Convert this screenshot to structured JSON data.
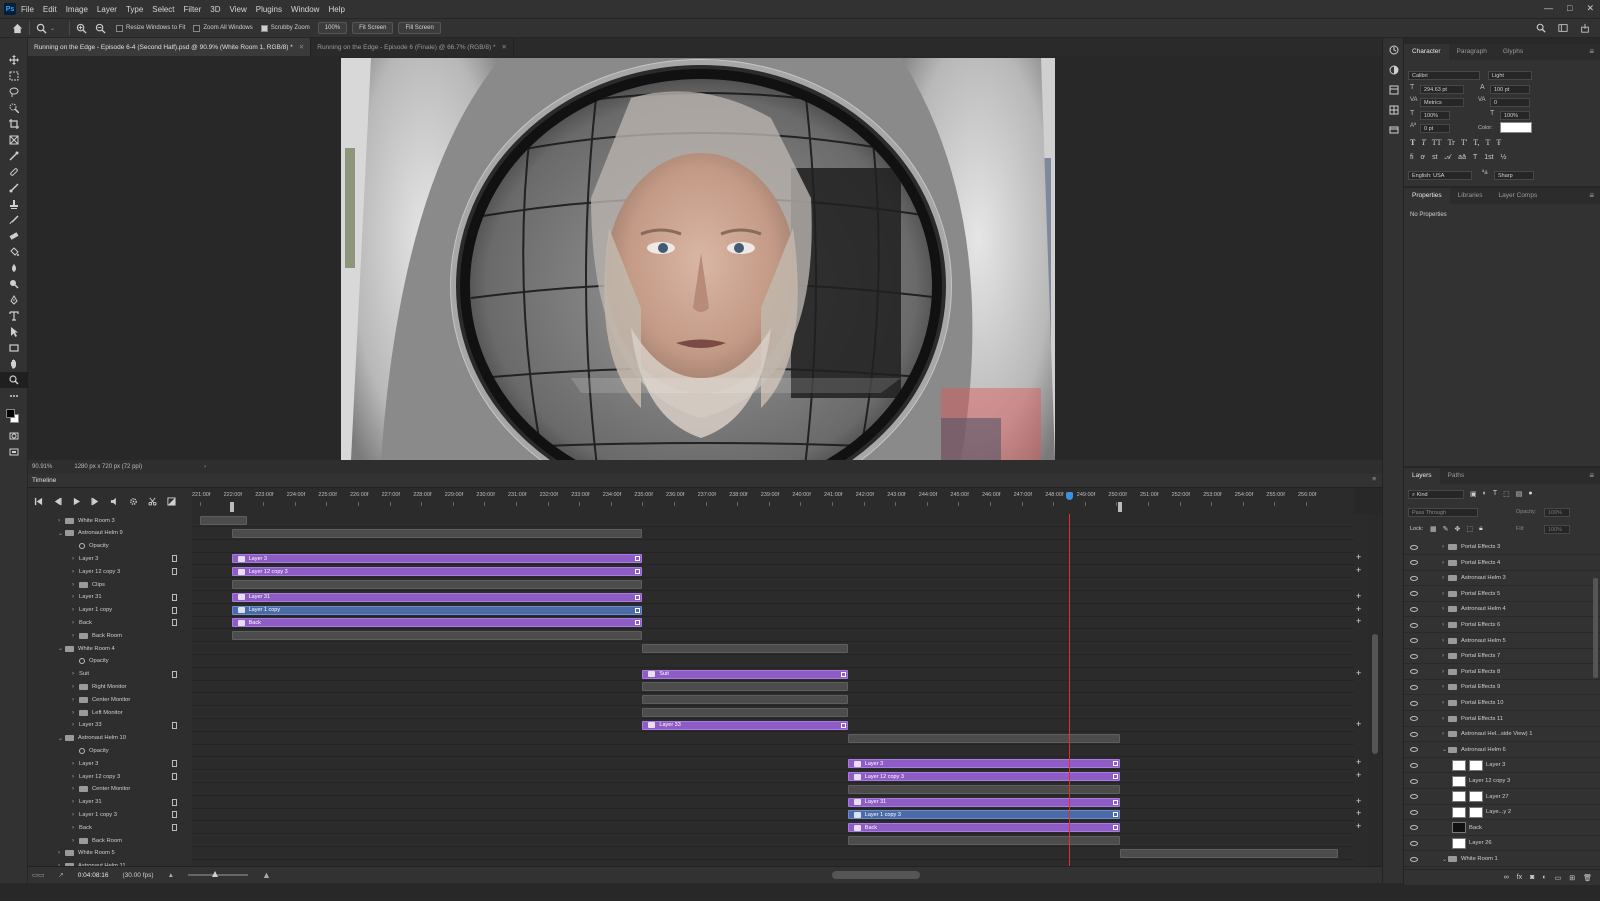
{
  "menu": [
    "File",
    "Edit",
    "Image",
    "Layer",
    "Type",
    "Select",
    "Filter",
    "3D",
    "View",
    "Plugins",
    "Window",
    "Help"
  ],
  "ps_logo": "Ps",
  "window_controls": [
    "—",
    "□",
    "✕"
  ],
  "options": {
    "resize_windows": "Resize Windows to Fit",
    "zoom_all": "Zoom All Windows",
    "scrubby_zoom": "Scrubby Zoom",
    "zoom_value": "100%",
    "fit_screen": "Fit Screen",
    "fill_screen": "Fill Screen"
  },
  "tabs": [
    {
      "label": "Running on the Edge - Episode 6-4 (Second Half).psd @ 90.9% (White Room 1, RGB/8) *",
      "active": true
    },
    {
      "label": "Running on the Edge - Episode 6 (Finale) @ 66.7% (RGB/8) *",
      "active": false
    }
  ],
  "status": {
    "zoom": "90.91%",
    "size": "1280 px x 720 px (72 ppi)"
  },
  "timeline": {
    "title": "Timeline",
    "ruler": [
      "221:00f",
      "222:00f",
      "223:00f",
      "224:00f",
      "225:00f",
      "226:00f",
      "227:00f",
      "228:00f",
      "229:00f",
      "230:00f",
      "231:00f",
      "232:00f",
      "233:00f",
      "234:00f",
      "235:00f",
      "236:00f",
      "237:00f",
      "238:00f",
      "239:00f",
      "240:00f",
      "241:00f",
      "242:00f",
      "243:00f",
      "244:00f",
      "245:00f",
      "246:00f",
      "247:00f",
      "248:00f",
      "249:00f",
      "250:00f",
      "251:00f",
      "252:00f",
      "253:00f",
      "254:00f",
      "255:00f",
      "256:00f"
    ],
    "timecode": "0:04:08:16",
    "fps": "(30.00 fps)",
    "tracks": [
      {
        "name": "White Room 3",
        "indent": 1,
        "kind": "folder",
        "collapsed": true
      },
      {
        "name": "Astronaut Helm 9",
        "indent": 1,
        "kind": "folder",
        "collapsed": false
      },
      {
        "name": "Opacity",
        "indent": 2,
        "kind": "prop"
      },
      {
        "name": "Layer 3",
        "indent": 2,
        "kind": "layer"
      },
      {
        "name": "Layer 12 copy 3",
        "indent": 2,
        "kind": "layer"
      },
      {
        "name": "Clips",
        "indent": 2,
        "kind": "folder",
        "collapsed": true
      },
      {
        "name": "Layer 31",
        "indent": 2,
        "kind": "layer"
      },
      {
        "name": "Layer 1 copy",
        "indent": 2,
        "kind": "layer"
      },
      {
        "name": "Back",
        "indent": 2,
        "kind": "layer"
      },
      {
        "name": "Back Room",
        "indent": 2,
        "kind": "folder",
        "collapsed": true
      },
      {
        "name": "White Room 4",
        "indent": 1,
        "kind": "folder",
        "collapsed": false
      },
      {
        "name": "Opacity",
        "indent": 2,
        "kind": "prop"
      },
      {
        "name": "Suit",
        "indent": 2,
        "kind": "layer"
      },
      {
        "name": "Right Monitor",
        "indent": 2,
        "kind": "folder",
        "collapsed": true
      },
      {
        "name": "Center Monitor",
        "indent": 2,
        "kind": "folder",
        "collapsed": true
      },
      {
        "name": "Left Monitor",
        "indent": 2,
        "kind": "folder",
        "collapsed": true
      },
      {
        "name": "Layer 33",
        "indent": 2,
        "kind": "layer"
      },
      {
        "name": "Astronaut Helm 10",
        "indent": 1,
        "kind": "folder",
        "collapsed": false
      },
      {
        "name": "Opacity",
        "indent": 2,
        "kind": "prop"
      },
      {
        "name": "Layer 3",
        "indent": 2,
        "kind": "layer"
      },
      {
        "name": "Layer 12 copy 3",
        "indent": 2,
        "kind": "layer"
      },
      {
        "name": "Center Monitor",
        "indent": 2,
        "kind": "folder",
        "collapsed": true
      },
      {
        "name": "Layer 31",
        "indent": 2,
        "kind": "layer"
      },
      {
        "name": "Layer 1 copy 3",
        "indent": 2,
        "kind": "layer"
      },
      {
        "name": "Back",
        "indent": 2,
        "kind": "layer"
      },
      {
        "name": "Back Room",
        "indent": 2,
        "kind": "folder",
        "collapsed": true
      },
      {
        "name": "White Room 5",
        "indent": 1,
        "kind": "folder",
        "collapsed": true
      },
      {
        "name": "Astronaut Helm 11",
        "indent": 1,
        "kind": "folder",
        "collapsed": true
      }
    ],
    "clips": [
      {
        "row": 0,
        "start": 221.0,
        "end": 222.5,
        "label": "",
        "color": "grey"
      },
      {
        "row": 1,
        "start": 222.0,
        "end": 235.0,
        "label": "",
        "color": "grey"
      },
      {
        "row": 3,
        "start": 222.0,
        "end": 235.0,
        "label": "Layer 3",
        "color": "purple"
      },
      {
        "row": 4,
        "start": 222.0,
        "end": 235.0,
        "label": "Layer 12 copy 3",
        "color": "purple"
      },
      {
        "row": 5,
        "start": 222.0,
        "end": 235.0,
        "label": "",
        "color": "grey"
      },
      {
        "row": 6,
        "start": 222.0,
        "end": 235.0,
        "label": "Layer 31",
        "color": "purple"
      },
      {
        "row": 7,
        "start": 222.0,
        "end": 235.0,
        "label": "Layer 1 copy",
        "color": "blue"
      },
      {
        "row": 8,
        "start": 222.0,
        "end": 235.0,
        "label": "Back",
        "color": "purple"
      },
      {
        "row": 9,
        "start": 222.0,
        "end": 235.0,
        "label": "",
        "color": "grey"
      },
      {
        "row": 10,
        "start": 235.0,
        "end": 241.5,
        "label": "",
        "color": "grey"
      },
      {
        "row": 12,
        "start": 235.0,
        "end": 241.5,
        "label": "Suit",
        "color": "purple"
      },
      {
        "row": 13,
        "start": 235.0,
        "end": 241.5,
        "label": "",
        "color": "grey"
      },
      {
        "row": 14,
        "start": 235.0,
        "end": 241.5,
        "label": "",
        "color": "grey"
      },
      {
        "row": 15,
        "start": 235.0,
        "end": 241.5,
        "label": "",
        "color": "grey"
      },
      {
        "row": 16,
        "start": 235.0,
        "end": 241.5,
        "label": "Layer 33",
        "color": "purple"
      },
      {
        "row": 17,
        "start": 241.5,
        "end": 250.1,
        "label": "",
        "color": "grey"
      },
      {
        "row": 19,
        "start": 241.5,
        "end": 250.1,
        "label": "Layer 3",
        "color": "purple"
      },
      {
        "row": 20,
        "start": 241.5,
        "end": 250.1,
        "label": "Layer 12 copy 3",
        "color": "purple"
      },
      {
        "row": 21,
        "start": 241.5,
        "end": 250.1,
        "label": "",
        "color": "grey"
      },
      {
        "row": 22,
        "start": 241.5,
        "end": 250.1,
        "label": "Layer 31",
        "color": "purple"
      },
      {
        "row": 23,
        "start": 241.5,
        "end": 250.1,
        "label": "Layer 1 copy 3",
        "color": "blue"
      },
      {
        "row": 24,
        "start": 241.5,
        "end": 250.1,
        "label": "Back",
        "color": "purple"
      },
      {
        "row": 25,
        "start": 241.5,
        "end": 250.1,
        "label": "",
        "color": "grey"
      },
      {
        "row": 26,
        "start": 250.1,
        "end": 257.0,
        "label": "",
        "color": "grey"
      }
    ],
    "plus_rows": [
      3,
      4,
      6,
      7,
      8,
      12,
      16,
      19,
      20,
      22,
      23,
      24
    ],
    "playhead_frame": 248.5
  },
  "character": {
    "tabs": [
      "Character",
      "Paragraph",
      "Glyphs"
    ],
    "font": "Calibri",
    "style": "Light",
    "size": "294.63 pt",
    "leading": "100 pt",
    "kerning": "Metrics",
    "tracking": "0",
    "vscale": "100%",
    "hscale": "100%",
    "baseline": "0 pt",
    "color_label": "Color:",
    "style_buttons": [
      "T",
      "T",
      "TT",
      "Tr",
      "T'",
      "T,",
      "T",
      "Ŧ"
    ],
    "language": "English: USA",
    "aa": "Sharp"
  },
  "properties": {
    "tabs": [
      "Properties",
      "Libraries",
      "Layer Comps"
    ],
    "empty": "No Properties"
  },
  "layers": {
    "tabs": [
      "Layers",
      "Paths"
    ],
    "filter": "Kind",
    "blend": "Pass Through",
    "opacity_label": "Opacity:",
    "opacity": "100%",
    "lock_label": "Lock:",
    "fill_label": "Fill:",
    "fill": "100%",
    "items": [
      {
        "name": "Portal Effects 3",
        "type": "folder",
        "indent": 1
      },
      {
        "name": "Portal Effects 4",
        "type": "folder",
        "indent": 1
      },
      {
        "name": "Astronaut Helm 3",
        "type": "folder",
        "indent": 1
      },
      {
        "name": "Portal Effects 5",
        "type": "folder",
        "indent": 1
      },
      {
        "name": "Astronaut Helm 4",
        "type": "folder",
        "indent": 1
      },
      {
        "name": "Portal Effects 6",
        "type": "folder",
        "indent": 1
      },
      {
        "name": "Astronaut Helm 5",
        "type": "folder",
        "indent": 1
      },
      {
        "name": "Portal Effects 7",
        "type": "folder",
        "indent": 1
      },
      {
        "name": "Portal Effects 8",
        "type": "folder",
        "indent": 1
      },
      {
        "name": "Portal Effects 9",
        "type": "folder",
        "indent": 1
      },
      {
        "name": "Portal Effects 10",
        "type": "folder",
        "indent": 1
      },
      {
        "name": "Portal Effects 11",
        "type": "folder",
        "indent": 1
      },
      {
        "name": "Astronaut Hel...side View) 1",
        "type": "folder",
        "indent": 1
      },
      {
        "name": "Astronaut Helm 6",
        "type": "folder",
        "indent": 1
      },
      {
        "name": "Layer 3",
        "type": "layer",
        "indent": 2
      },
      {
        "name": "Layer 12 copy 3",
        "type": "layer",
        "indent": 2
      },
      {
        "name": "Layer 27",
        "type": "layer",
        "indent": 2
      },
      {
        "name": "Laye...y 2",
        "type": "layer",
        "indent": 2
      },
      {
        "name": "Back",
        "type": "layer",
        "indent": 2
      },
      {
        "name": "Layer 26",
        "type": "layer",
        "indent": 2
      },
      {
        "name": "White Room 1",
        "type": "folder",
        "indent": 1
      }
    ]
  }
}
